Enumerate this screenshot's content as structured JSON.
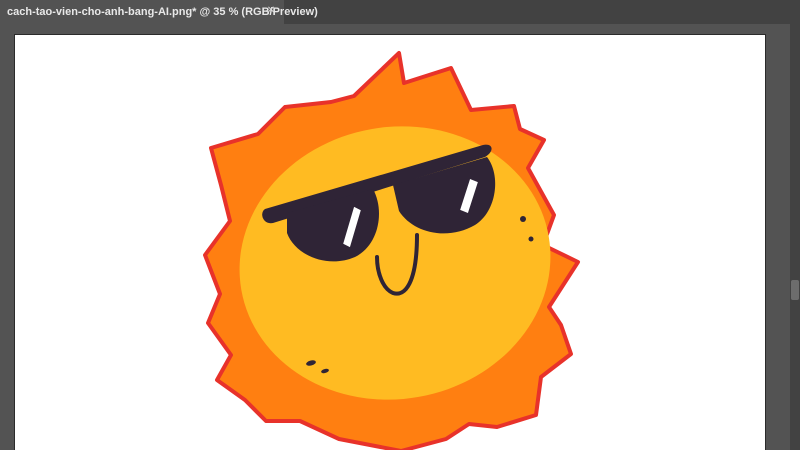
{
  "document": {
    "tab_title": "cach-tao-vien-cho-anh-bang-AI.png* @ 35 % (RGB/Preview)",
    "close_glyph": "✕"
  },
  "artwork": {
    "subject": "sun-with-sunglasses-illustration",
    "colors": {
      "outline": "#e8322a",
      "rays": "#ff7f11",
      "face": "#ffbb22",
      "sunglasses": "#2f2436",
      "highlight": "#ffffff"
    }
  },
  "theme": {
    "background": "#535353",
    "tabbar": "#424242",
    "artboard": "#ffffff"
  }
}
